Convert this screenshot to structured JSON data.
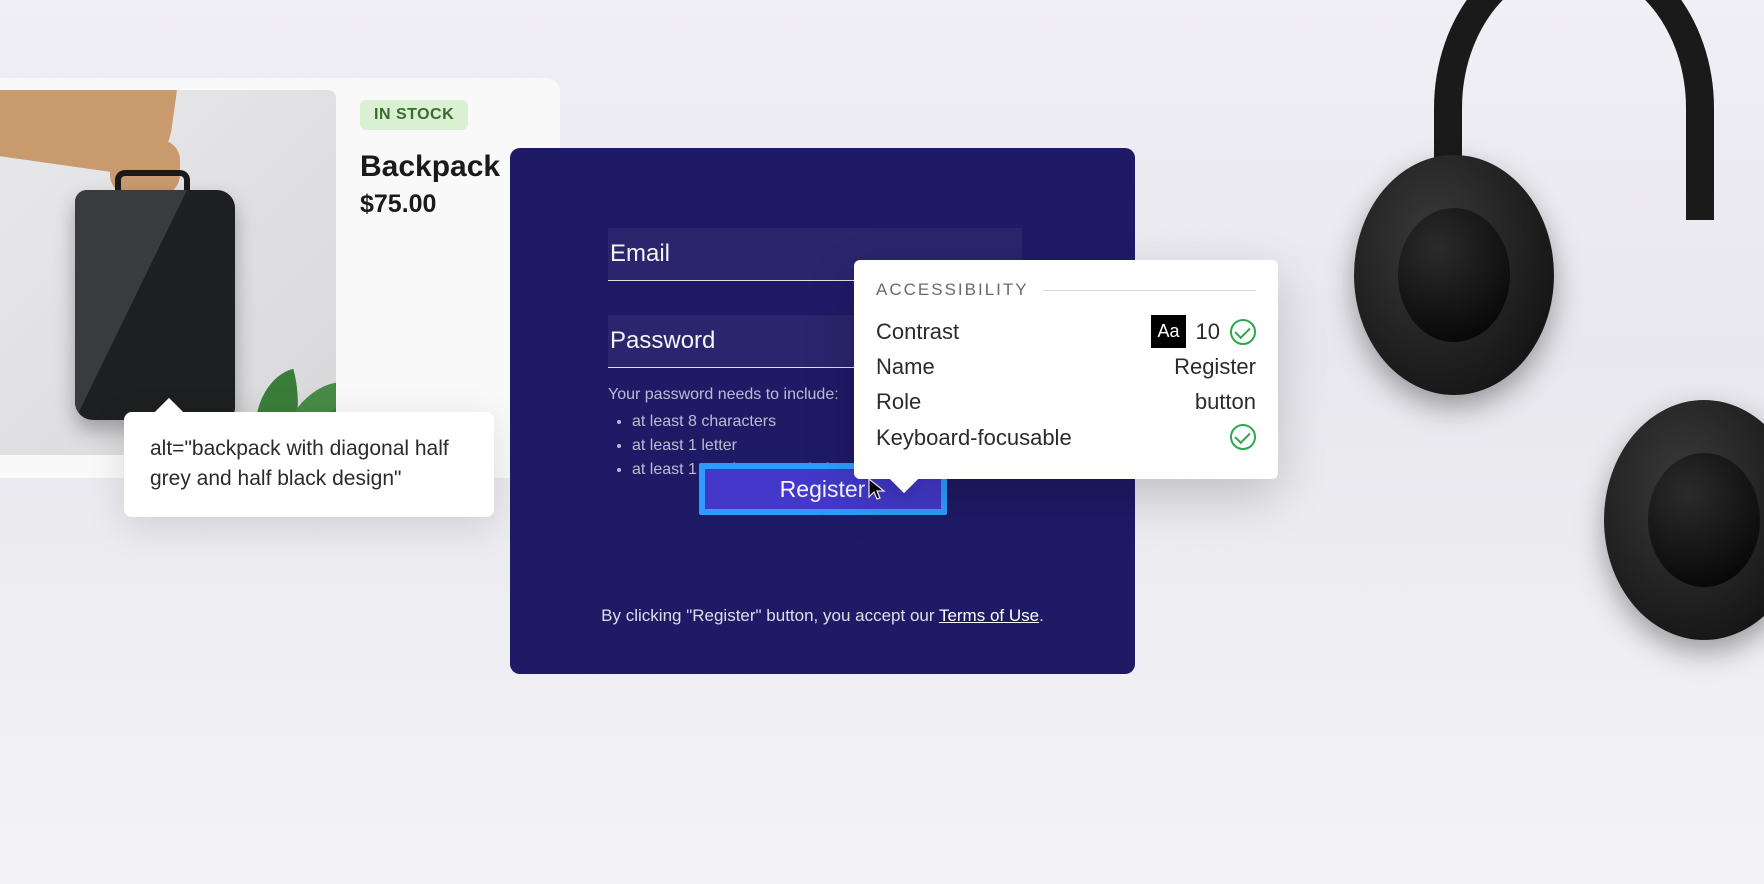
{
  "product": {
    "stock_badge": "IN STOCK",
    "title": "Backpack",
    "price": "$75.00",
    "alt_text": "alt=\"backpack with diagonal half grey and half black design\""
  },
  "form": {
    "email_label": "Email",
    "password_label": "Password",
    "password_hint": "Your password needs to include:",
    "password_rules": [
      "at least 8 characters",
      "at least 1 letter",
      "at least 1 number or symbol"
    ],
    "register_label": "Register",
    "terms_prefix": "By clicking \"Register\" button, you accept our ",
    "terms_link": "Terms of Use",
    "terms_suffix": "."
  },
  "a11y": {
    "heading": "ACCESSIBILITY",
    "rows": {
      "contrast_label": "Contrast",
      "contrast_chip": "Aa",
      "contrast_value": "10",
      "name_label": "Name",
      "name_value": "Register",
      "role_label": "Role",
      "role_value": "button",
      "focusable_label": "Keyboard-focusable"
    }
  }
}
